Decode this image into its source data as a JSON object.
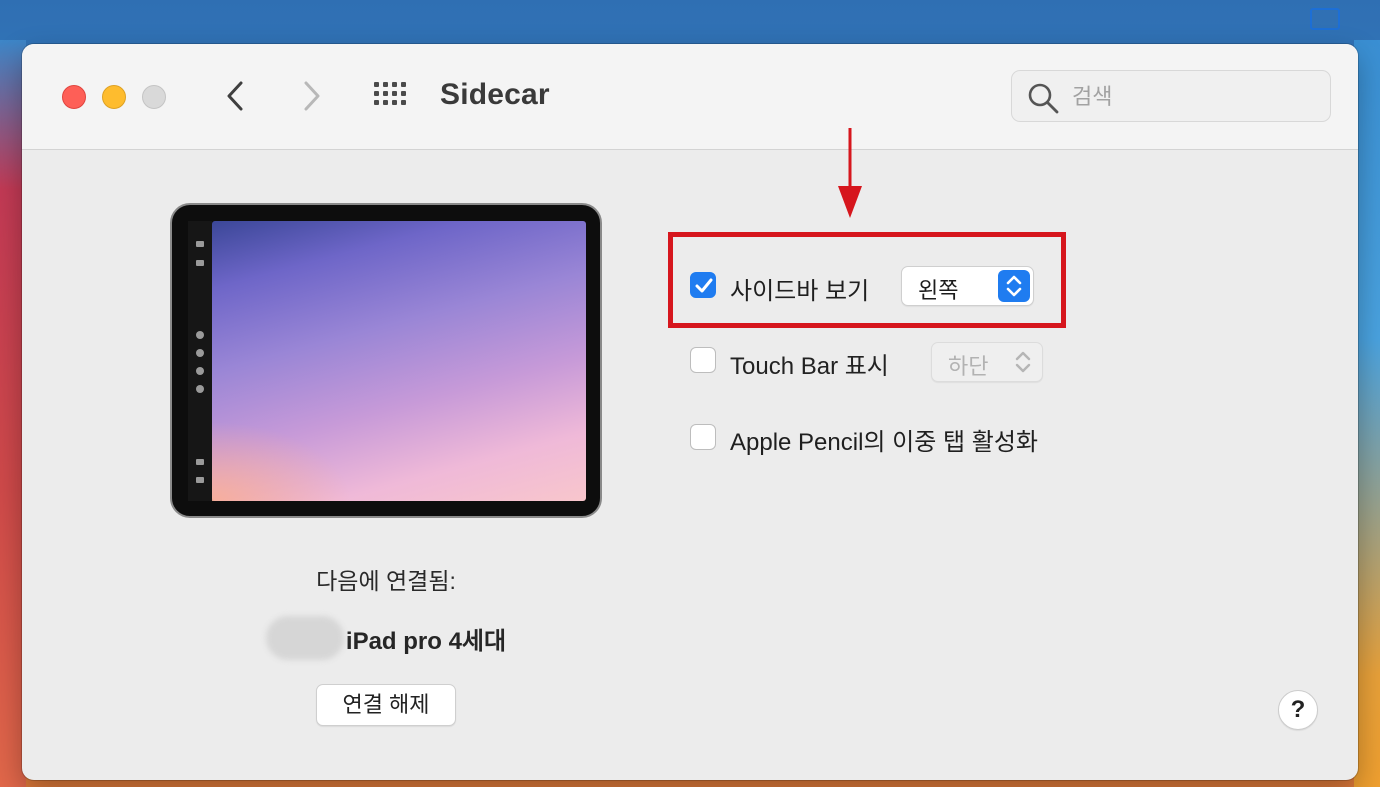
{
  "window": {
    "title": "Sidecar",
    "search_placeholder": "검색"
  },
  "device_panel": {
    "connected_label": "다음에 연결됨:",
    "device_name": "iPad pro 4세대",
    "disconnect_label": "연결 해제"
  },
  "options": {
    "sidebar": {
      "label": "사이드바 보기",
      "checked": true,
      "value": "왼쪽"
    },
    "touchbar": {
      "label": "Touch Bar 표시",
      "checked": false,
      "value": "하단"
    },
    "pencil": {
      "label": "Apple Pencil의 이중 탭 활성화",
      "checked": false
    }
  },
  "help_label": "?",
  "colors": {
    "accent": "#1f7cf0",
    "annotation": "#d6161d"
  }
}
